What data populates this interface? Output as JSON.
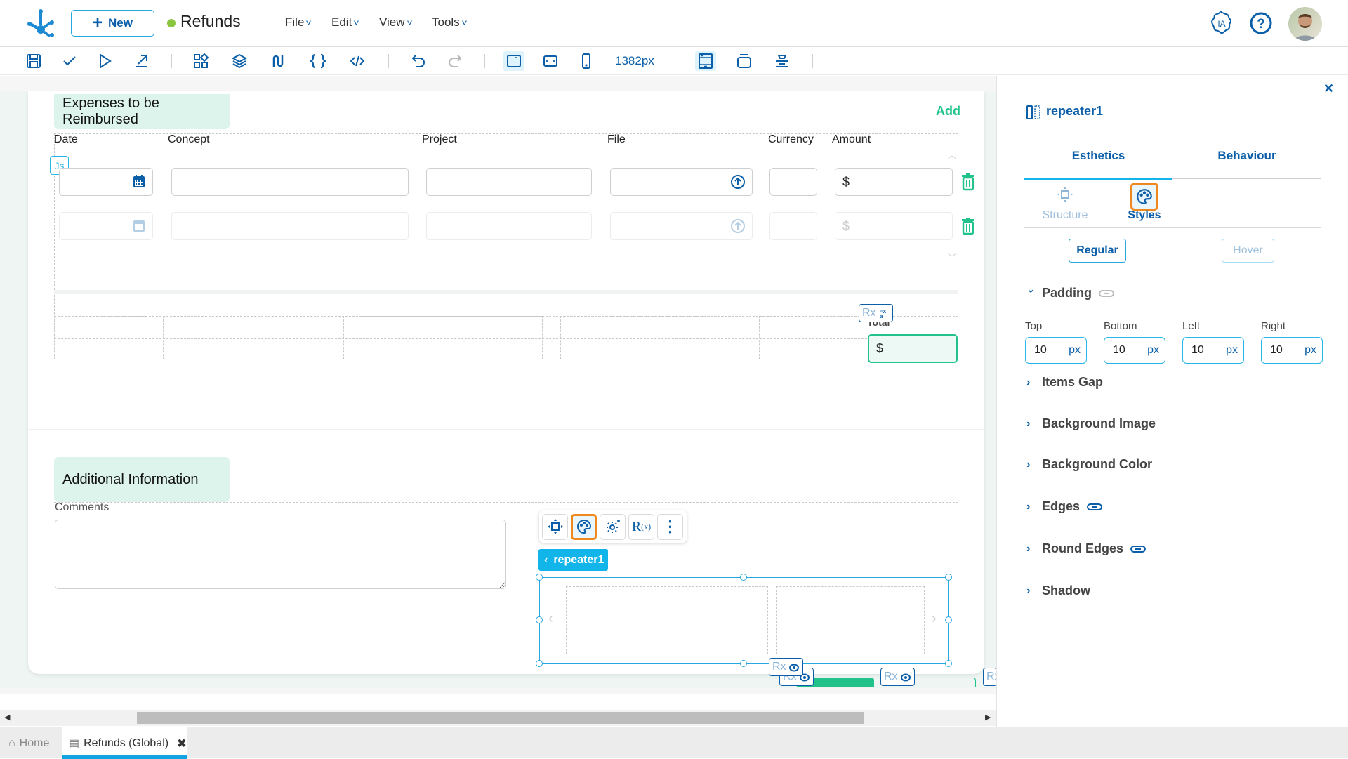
{
  "header": {
    "new_button": "New",
    "app_title": "Refunds",
    "app_status_color": "#8cc63f",
    "menus": [
      "File",
      "Edit",
      "View",
      "Tools"
    ],
    "ia_label": "IA"
  },
  "toolbar": {
    "width_value": "1382px"
  },
  "canvas": {
    "expenses_section": {
      "title": "Expenses to be Reimbursed",
      "add_link": "Add",
      "columns": [
        "Date",
        "Concept",
        "Project",
        "File",
        "Currency",
        "Amount"
      ],
      "amount_prefix": "$",
      "js_badge": "Js"
    },
    "total": {
      "label": "Total",
      "prefix": "$"
    },
    "additional_section": {
      "title": "Additional Information",
      "comments_label": "Comments",
      "comments_value": ""
    },
    "selected_component": "repeater1",
    "rx_badge": "Rx"
  },
  "panel": {
    "component_name": "repeater1",
    "tabs": [
      "Esthetics",
      "Behaviour"
    ],
    "active_tab": "Esthetics",
    "subtabs": [
      "Structure",
      "Styles"
    ],
    "active_subtab": "Styles",
    "state_buttons": [
      "Regular",
      "Hover"
    ],
    "padding": {
      "title": "Padding",
      "fields": [
        {
          "label": "Top",
          "value": "10",
          "unit": "px"
        },
        {
          "label": "Bottom",
          "value": "10",
          "unit": "px"
        },
        {
          "label": "Left",
          "value": "10",
          "unit": "px"
        },
        {
          "label": "Right",
          "value": "10",
          "unit": "px"
        }
      ]
    },
    "sections": [
      "Items Gap",
      "Background Image",
      "Background Color",
      "Edges",
      "Round Edges",
      "Shadow"
    ]
  },
  "bottom_tabs": {
    "home": "Home",
    "active": "Refunds (Global)"
  },
  "colors": {
    "accent": "#0b5fa8",
    "highlight": "#12b5ea",
    "success": "#22c38a",
    "selected_outline": "#f0891d"
  }
}
